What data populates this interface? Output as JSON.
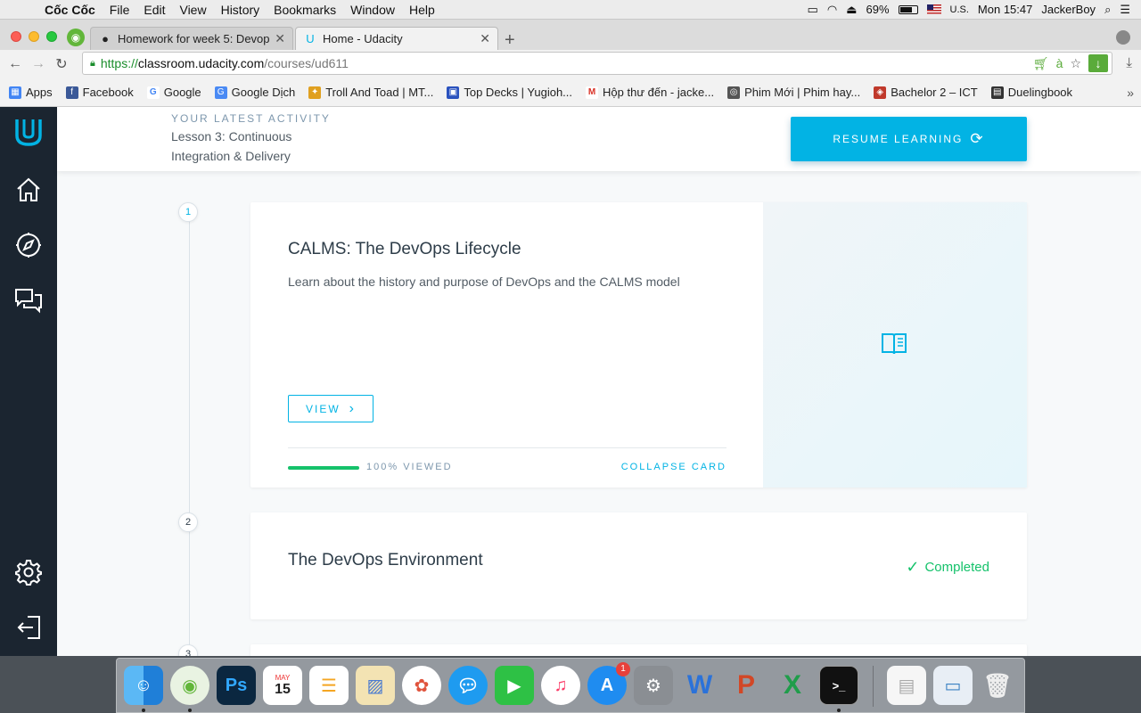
{
  "menubar": {
    "app_name": "Cốc Cốc",
    "items": [
      "File",
      "Edit",
      "View",
      "History",
      "Bookmarks",
      "Window",
      "Help"
    ],
    "battery": "69%",
    "input_source": "U.S.",
    "clock": "Mon 15:47",
    "user": "JackerBoy"
  },
  "browser": {
    "tabs": [
      {
        "title": "Homework for week 5: Devops",
        "icon": "github-icon"
      },
      {
        "title": "Home - Udacity",
        "icon": "udacity-icon"
      }
    ],
    "url": {
      "scheme": "https://",
      "host": "classroom.udacity.com",
      "path": "/courses/ud611"
    },
    "bookmarks": [
      {
        "label": "Apps",
        "icon": "apps-grid-icon",
        "color": "#4285f4"
      },
      {
        "label": "Facebook",
        "icon": "facebook-icon",
        "color": "#3b5998"
      },
      {
        "label": "Google",
        "icon": "google-icon",
        "color": "#4285f4"
      },
      {
        "label": "Google Dịch",
        "icon": "google-translate-icon",
        "color": "#4a8af4"
      },
      {
        "label": "Troll And Toad | MT...",
        "icon": "trollandtoad-icon",
        "color": "#e0a020"
      },
      {
        "label": "Top Decks | Yugioh...",
        "icon": "topdecks-icon",
        "color": "#2a52be"
      },
      {
        "label": "Hộp thư đến - jacke...",
        "icon": "gmail-icon",
        "color": "#d93025"
      },
      {
        "label": "Phim Mới | Phim hay...",
        "icon": "phimmoi-icon",
        "color": "#555555"
      },
      {
        "label": "Bachelor 2 – ICT",
        "icon": "ict-icon",
        "color": "#c0392b"
      },
      {
        "label": "Duelingbook",
        "icon": "duelingbook-icon",
        "color": "#333333"
      }
    ]
  },
  "activity": {
    "label": "YOUR LATEST ACTIVITY",
    "title": "Lesson 3: Continuous Integration & Delivery",
    "resume_label": "RESUME LEARNING"
  },
  "lessons": [
    {
      "number": "1",
      "title": "CALMS: The DevOps Lifecycle",
      "description": "Learn about the history and purpose of DevOps and the CALMS model",
      "view_label": "VIEW",
      "progress_fraction": 1.0,
      "progress_text": "100% VIEWED",
      "collapse_label": "COLLAPSE CARD"
    },
    {
      "number": "2",
      "title": "The DevOps Environment",
      "status": "Completed"
    },
    {
      "number": "3"
    }
  ],
  "dock": {
    "calendar_month": "MAY",
    "calendar_day": "15",
    "appstore_badge": "1"
  },
  "colors": {
    "accent": "#02b3e4",
    "success": "#15c26b",
    "sidebar": "#1b2530"
  }
}
